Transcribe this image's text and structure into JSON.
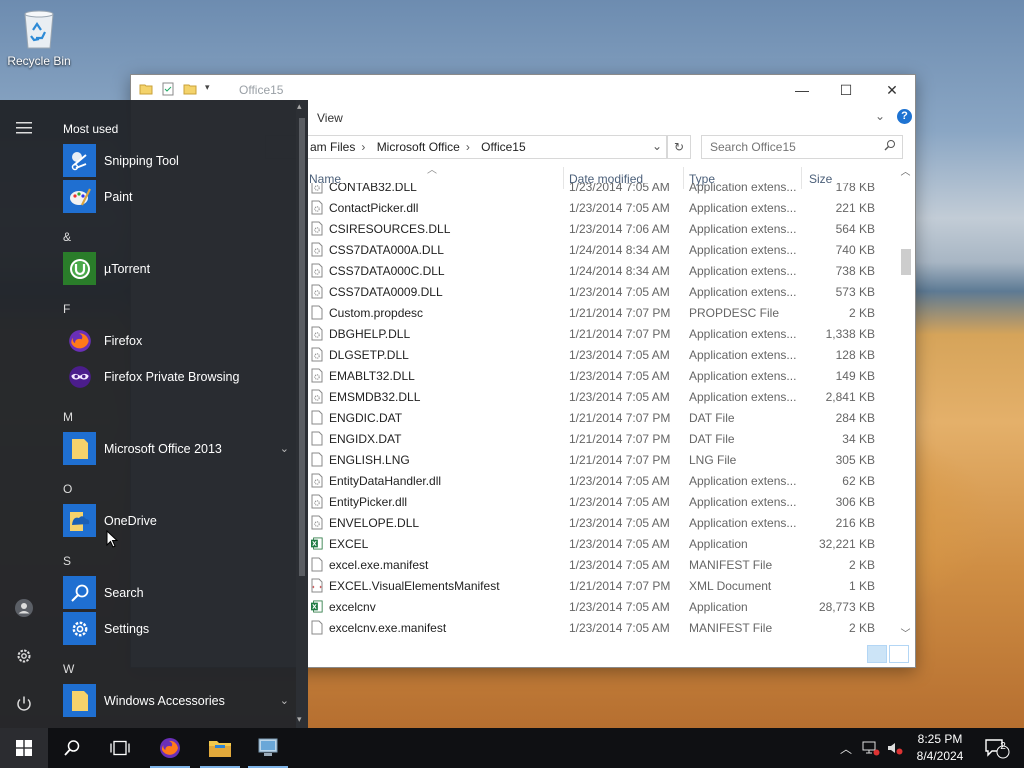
{
  "desktop": {
    "icons": [
      {
        "label": "Recycle Bin",
        "icon": "recycle-bin-icon"
      }
    ]
  },
  "explorer": {
    "title": "Office15",
    "ribbon_tab": "View",
    "address": {
      "crumbs": [
        "am Files",
        "Microsoft Office",
        "Office15"
      ]
    },
    "search_placeholder": "Search Office15",
    "columns": {
      "name": "Name",
      "date": "Date modified",
      "type": "Type",
      "size": "Size"
    },
    "files": [
      {
        "name": "CONTAB32.DLL",
        "date": "1/23/2014 7:05 AM",
        "type": "Application extens...",
        "size": "178 KB",
        "icon": "dll"
      },
      {
        "name": "ContactPicker.dll",
        "date": "1/23/2014 7:05 AM",
        "type": "Application extens...",
        "size": "221 KB",
        "icon": "dll"
      },
      {
        "name": "CSIRESOURCES.DLL",
        "date": "1/23/2014 7:06 AM",
        "type": "Application extens...",
        "size": "564 KB",
        "icon": "dll"
      },
      {
        "name": "CSS7DATA000A.DLL",
        "date": "1/24/2014 8:34 AM",
        "type": "Application extens...",
        "size": "740 KB",
        "icon": "dll"
      },
      {
        "name": "CSS7DATA000C.DLL",
        "date": "1/24/2014 8:34 AM",
        "type": "Application extens...",
        "size": "738 KB",
        "icon": "dll"
      },
      {
        "name": "CSS7DATA0009.DLL",
        "date": "1/23/2014 7:05 AM",
        "type": "Application extens...",
        "size": "573 KB",
        "icon": "dll"
      },
      {
        "name": "Custom.propdesc",
        "date": "1/21/2014 7:07 PM",
        "type": "PROPDESC File",
        "size": "2 KB",
        "icon": "file"
      },
      {
        "name": "DBGHELP.DLL",
        "date": "1/21/2014 7:07 PM",
        "type": "Application extens...",
        "size": "1,338 KB",
        "icon": "dll"
      },
      {
        "name": "DLGSETP.DLL",
        "date": "1/23/2014 7:05 AM",
        "type": "Application extens...",
        "size": "128 KB",
        "icon": "dll"
      },
      {
        "name": "EMABLT32.DLL",
        "date": "1/23/2014 7:05 AM",
        "type": "Application extens...",
        "size": "149 KB",
        "icon": "dll"
      },
      {
        "name": "EMSMDB32.DLL",
        "date": "1/23/2014 7:05 AM",
        "type": "Application extens...",
        "size": "2,841 KB",
        "icon": "dll"
      },
      {
        "name": "ENGDIC.DAT",
        "date": "1/21/2014 7:07 PM",
        "type": "DAT File",
        "size": "284 KB",
        "icon": "file"
      },
      {
        "name": "ENGIDX.DAT",
        "date": "1/21/2014 7:07 PM",
        "type": "DAT File",
        "size": "34 KB",
        "icon": "file"
      },
      {
        "name": "ENGLISH.LNG",
        "date": "1/21/2014 7:07 PM",
        "type": "LNG File",
        "size": "305 KB",
        "icon": "file"
      },
      {
        "name": "EntityDataHandler.dll",
        "date": "1/23/2014 7:05 AM",
        "type": "Application extens...",
        "size": "62 KB",
        "icon": "dll"
      },
      {
        "name": "EntityPicker.dll",
        "date": "1/23/2014 7:05 AM",
        "type": "Application extens...",
        "size": "306 KB",
        "icon": "dll"
      },
      {
        "name": "ENVELOPE.DLL",
        "date": "1/23/2014 7:05 AM",
        "type": "Application extens...",
        "size": "216 KB",
        "icon": "dll"
      },
      {
        "name": "EXCEL",
        "date": "1/23/2014 7:05 AM",
        "type": "Application",
        "size": "32,221 KB",
        "icon": "excel"
      },
      {
        "name": "excel.exe.manifest",
        "date": "1/23/2014 7:05 AM",
        "type": "MANIFEST File",
        "size": "2 KB",
        "icon": "file"
      },
      {
        "name": "EXCEL.VisualElementsManifest",
        "date": "1/21/2014 7:07 PM",
        "type": "XML Document",
        "size": "1 KB",
        "icon": "xml"
      },
      {
        "name": "excelcnv",
        "date": "1/23/2014 7:05 AM",
        "type": "Application",
        "size": "28,773 KB",
        "icon": "excel"
      },
      {
        "name": "excelcnv.exe.manifest",
        "date": "1/23/2014 7:05 AM",
        "type": "MANIFEST File",
        "size": "2 KB",
        "icon": "file"
      }
    ]
  },
  "startmenu": {
    "heading": "Most used",
    "items": [
      {
        "kind": "item",
        "label": "Snipping Tool",
        "icon": "snipping-tool-icon"
      },
      {
        "kind": "item",
        "label": "Paint",
        "icon": "paint-icon"
      },
      {
        "kind": "letter",
        "label": "&"
      },
      {
        "kind": "item",
        "label": "µTorrent",
        "icon": "utorrent-icon"
      },
      {
        "kind": "letter",
        "label": "F"
      },
      {
        "kind": "item",
        "label": "Firefox",
        "icon": "firefox-icon"
      },
      {
        "kind": "item",
        "label": "Firefox Private Browsing",
        "icon": "firefox-private-icon"
      },
      {
        "kind": "letter",
        "label": "M"
      },
      {
        "kind": "item",
        "label": "Microsoft Office 2013",
        "icon": "folder-icon",
        "expandable": true
      },
      {
        "kind": "letter",
        "label": "O"
      },
      {
        "kind": "item",
        "label": "OneDrive",
        "icon": "onedrive-icon"
      },
      {
        "kind": "letter",
        "label": "S"
      },
      {
        "kind": "item",
        "label": "Search",
        "icon": "search-icon"
      },
      {
        "kind": "item",
        "label": "Settings",
        "icon": "gear-icon"
      },
      {
        "kind": "letter",
        "label": "W"
      },
      {
        "kind": "item",
        "label": "Windows Accessories",
        "icon": "folder-icon",
        "expandable": true
      }
    ]
  },
  "taskbar": {
    "time": "8:25 PM",
    "date": "8/4/2024",
    "notification_count": "2"
  },
  "colors": {
    "accent": "#1f6fd1",
    "startmenu_bg": "#22252a",
    "taskbar_bg": "#0f1013"
  }
}
